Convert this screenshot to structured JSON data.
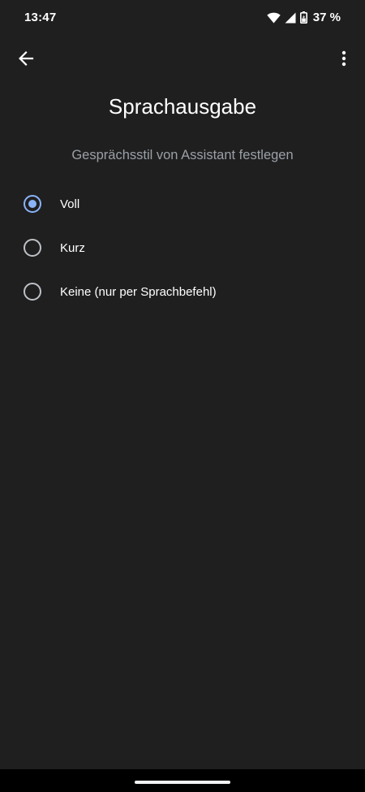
{
  "status_bar": {
    "time": "13:47",
    "battery": "37 %",
    "icons": [
      "wifi-icon",
      "signal-icon",
      "battery-icon"
    ]
  },
  "app_bar": {
    "back_icon": "arrow-back-icon",
    "more_icon": "more-vert-icon"
  },
  "page": {
    "title": "Sprachausgabe",
    "subtitle": "Gesprächsstil von Assistant festlegen"
  },
  "options": [
    {
      "label": "Voll",
      "selected": true
    },
    {
      "label": "Kurz",
      "selected": false
    },
    {
      "label": "Keine (nur per Sprachbefehl)",
      "selected": false
    }
  ],
  "colors": {
    "background": "#1f1f1f",
    "accent": "#8ab4f8",
    "subtitle": "#9aa0a6"
  }
}
